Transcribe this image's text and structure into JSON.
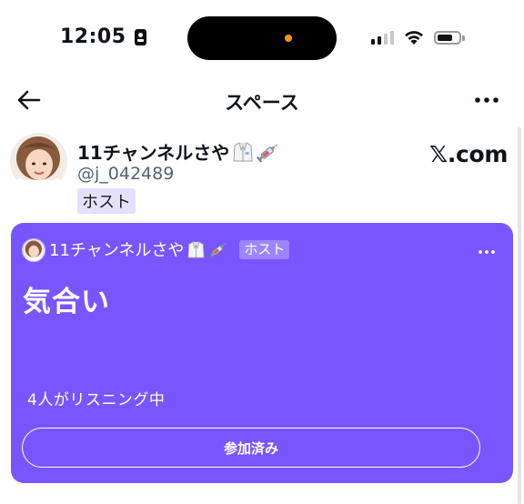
{
  "status_bar": {
    "time": "12:05"
  },
  "header": {
    "title": "スペース"
  },
  "tweet": {
    "author_name": "11チャンネルさや",
    "author_handle": "@j_042489",
    "host_badge": "ホスト",
    "source_label": "𝕏.com",
    "name_emojis": [
      "lab-coat",
      "syringe"
    ]
  },
  "space_card": {
    "host_name": "11チャンネルさや",
    "host_badge": "ホスト",
    "title": "気合い",
    "listeners_text": "4人がリスニング中",
    "button_label": "参加済み",
    "background_color": "#7856ff"
  },
  "colors": {
    "accent_purple": "#7856ff",
    "badge_bg": "#e6e0ff",
    "handle_gray": "#536471",
    "status_dot": "#f7931a"
  }
}
